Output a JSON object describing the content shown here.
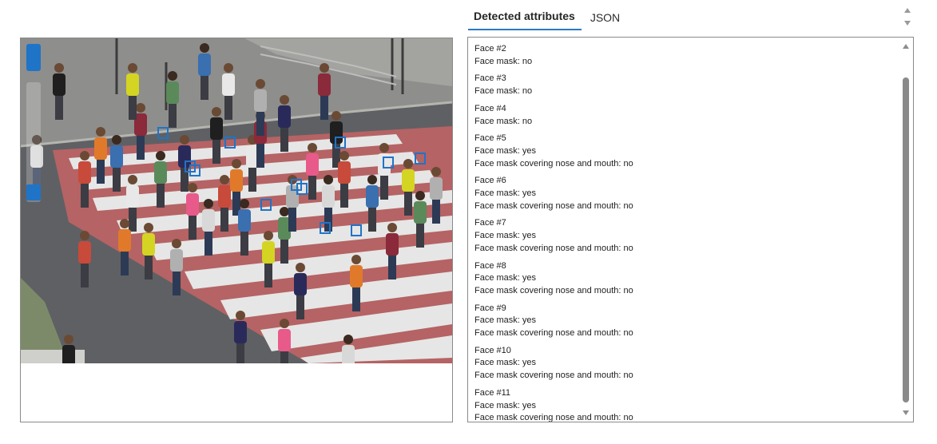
{
  "tabs": [
    {
      "label": "Detected attributes",
      "active": true
    },
    {
      "label": "JSON",
      "active": false
    }
  ],
  "colors": {
    "accent": "#2a79c4",
    "face_box": "#1f74c8"
  },
  "faces": [
    {
      "title": "Face #2",
      "lines": [
        "Face mask: no"
      ]
    },
    {
      "title": "Face #3",
      "lines": [
        "Face mask: no"
      ]
    },
    {
      "title": "Face #4",
      "lines": [
        "Face mask: no"
      ]
    },
    {
      "title": "Face #5",
      "lines": [
        "Face mask: yes",
        "Face mask covering nose and mouth: no"
      ]
    },
    {
      "title": "Face #6",
      "lines": [
        "Face mask: yes",
        "Face mask covering nose and mouth: no"
      ]
    },
    {
      "title": "Face #7",
      "lines": [
        "Face mask: yes",
        "Face mask covering nose and mouth: no"
      ]
    },
    {
      "title": "Face #8",
      "lines": [
        "Face mask: yes",
        "Face mask covering nose and mouth: no"
      ]
    },
    {
      "title": "Face #9",
      "lines": [
        "Face mask: yes",
        "Face mask covering nose and mouth: no"
      ]
    },
    {
      "title": "Face #10",
      "lines": [
        "Face mask: yes",
        "Face mask covering nose and mouth: no"
      ]
    },
    {
      "title": "Face #11",
      "lines": [
        "Face mask: yes",
        "Face mask covering nose and mouth: no"
      ]
    }
  ]
}
